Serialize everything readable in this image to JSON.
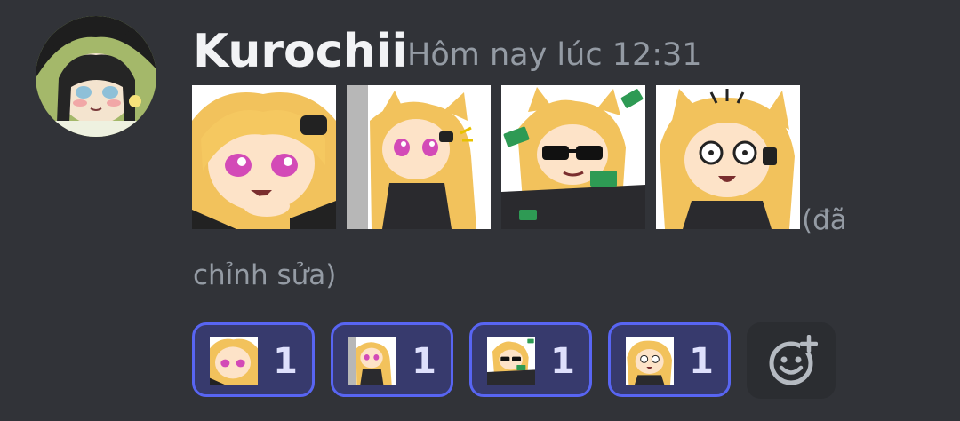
{
  "message": {
    "username": "Kurochii",
    "timestamp": "Hôm nay lúc 12:31",
    "edited_part1": "(đã",
    "edited_part2": "chỉnh sửa)"
  },
  "stickers": [
    {
      "icon": "chibi-thinking-sticker"
    },
    {
      "icon": "chibi-peeking-sticker"
    },
    {
      "icon": "chibi-sunglasses-money-sticker"
    },
    {
      "icon": "chibi-surprised-sticker"
    }
  ],
  "reactions": [
    {
      "icon": "chibi-thinking-emoji",
      "count": "1"
    },
    {
      "icon": "chibi-peeking-emoji",
      "count": "1"
    },
    {
      "icon": "chibi-sunglasses-money-emoji",
      "count": "1"
    },
    {
      "icon": "chibi-surprised-emoji",
      "count": "1"
    }
  ],
  "add_reaction": {
    "icon": "add-reaction-icon"
  },
  "colors": {
    "background": "#313338",
    "username": "#f2f3f5",
    "muted": "#949ba4",
    "reaction_border": "#5865f2",
    "reaction_bg": "#373a6d",
    "reaction_count": "#dee0fc",
    "add_reaction_bg": "#2b2d31"
  }
}
